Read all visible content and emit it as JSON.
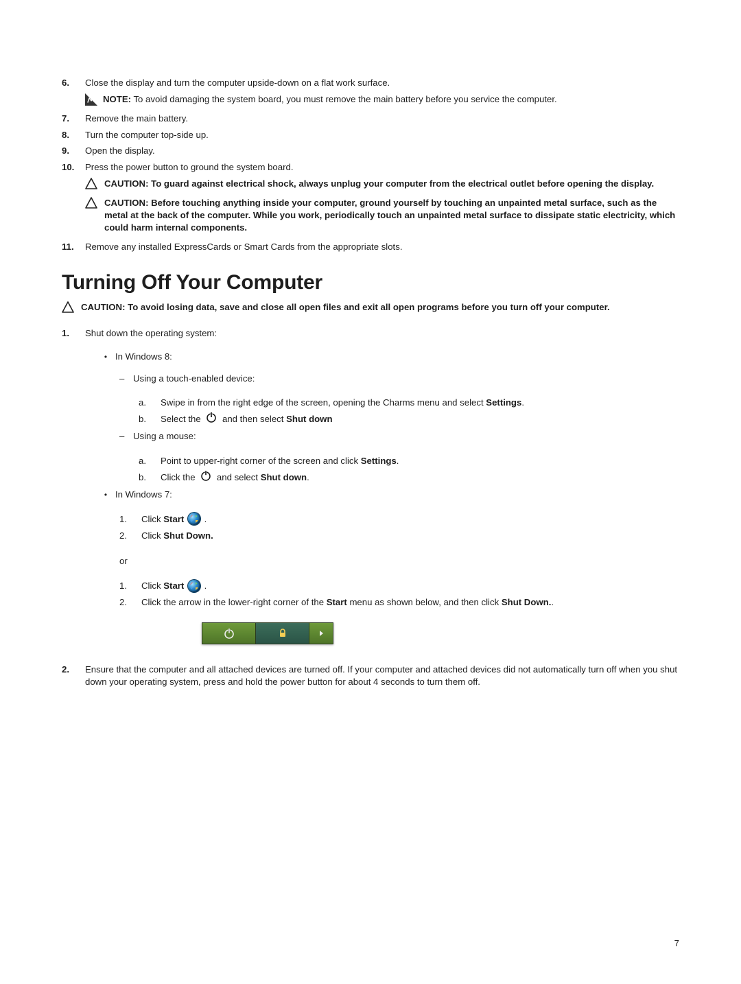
{
  "steps": {
    "s6": {
      "num": "6.",
      "text": "Close the display and turn the computer upside-down on a flat work surface."
    },
    "note": {
      "label": "NOTE:",
      "text": "To avoid damaging the system board, you must remove the main battery before you service the computer."
    },
    "s7": {
      "num": "7.",
      "text": "Remove the main battery."
    },
    "s8": {
      "num": "8.",
      "text": "Turn the computer top-side up."
    },
    "s9": {
      "num": "9.",
      "text": "Open the display."
    },
    "s10": {
      "num": "10.",
      "text": "Press the power button to ground the system board."
    },
    "c1": {
      "label": "CAUTION:",
      "text": "To guard against electrical shock, always unplug your computer from the electrical outlet before opening the display."
    },
    "c2": {
      "label": "CAUTION:",
      "text": "Before touching anything inside your computer, ground yourself by touching an unpainted metal surface, such as the metal at the back of the computer. While you work, periodically touch an unpainted metal surface to dissipate static electricity, which could harm internal components."
    },
    "s11": {
      "num": "11.",
      "text": "Remove any installed ExpressCards or Smart Cards from the appropriate slots."
    }
  },
  "section": {
    "title": "Turning Off Your Computer",
    "caution": {
      "label": "CAUTION:",
      "text": "To avoid losing data, save and close all open files and exit all open programs before you turn off your computer."
    }
  },
  "s1": {
    "num": "1.",
    "text": "Shut down the operating system:"
  },
  "win8": {
    "label": "In Windows 8:",
    "touch_label": "Using a touch-enabled device:",
    "touch_a": {
      "pre": "Swipe in from the right edge of the screen, opening the Charms menu and select ",
      "bold": "Settings",
      "post": "."
    },
    "touch_b": {
      "pre": "Select the ",
      "mid": " and then select ",
      "bold": "Shut down"
    },
    "mouse_label": "Using a mouse:",
    "mouse_a": {
      "pre": "Point to upper-right corner of the screen and click ",
      "bold": "Settings",
      "post": "."
    },
    "mouse_b": {
      "pre": "Click the ",
      "mid": " and select ",
      "bold": "Shut down",
      "post": "."
    }
  },
  "win7": {
    "label": "In Windows 7:",
    "p1_1": {
      "pre": "Click ",
      "bold": "Start",
      "post": " ."
    },
    "p1_2": {
      "pre": "Click ",
      "bold": "Shut Down."
    },
    "or": "or",
    "p2_1": {
      "pre": "Click ",
      "bold": "Start",
      "post": " ."
    },
    "p2_2": {
      "pre": "Click the arrow in the lower-right corner of the ",
      "bold": "Start",
      "mid": " menu as shown below, and then click ",
      "bold2": "Shut Down.",
      "post": "."
    }
  },
  "s2": {
    "num": "2.",
    "text": "Ensure that the computer and all attached devices are turned off. If your computer and attached devices did not automatically turn off when you shut down your operating system, press and hold the power button for about 4 seconds to turn them off."
  },
  "page_number": "7",
  "letters": {
    "a": "a.",
    "b": "b.",
    "n1": "1.",
    "n2": "2."
  },
  "bullets": {
    "dash": "–",
    "dot": "•"
  }
}
